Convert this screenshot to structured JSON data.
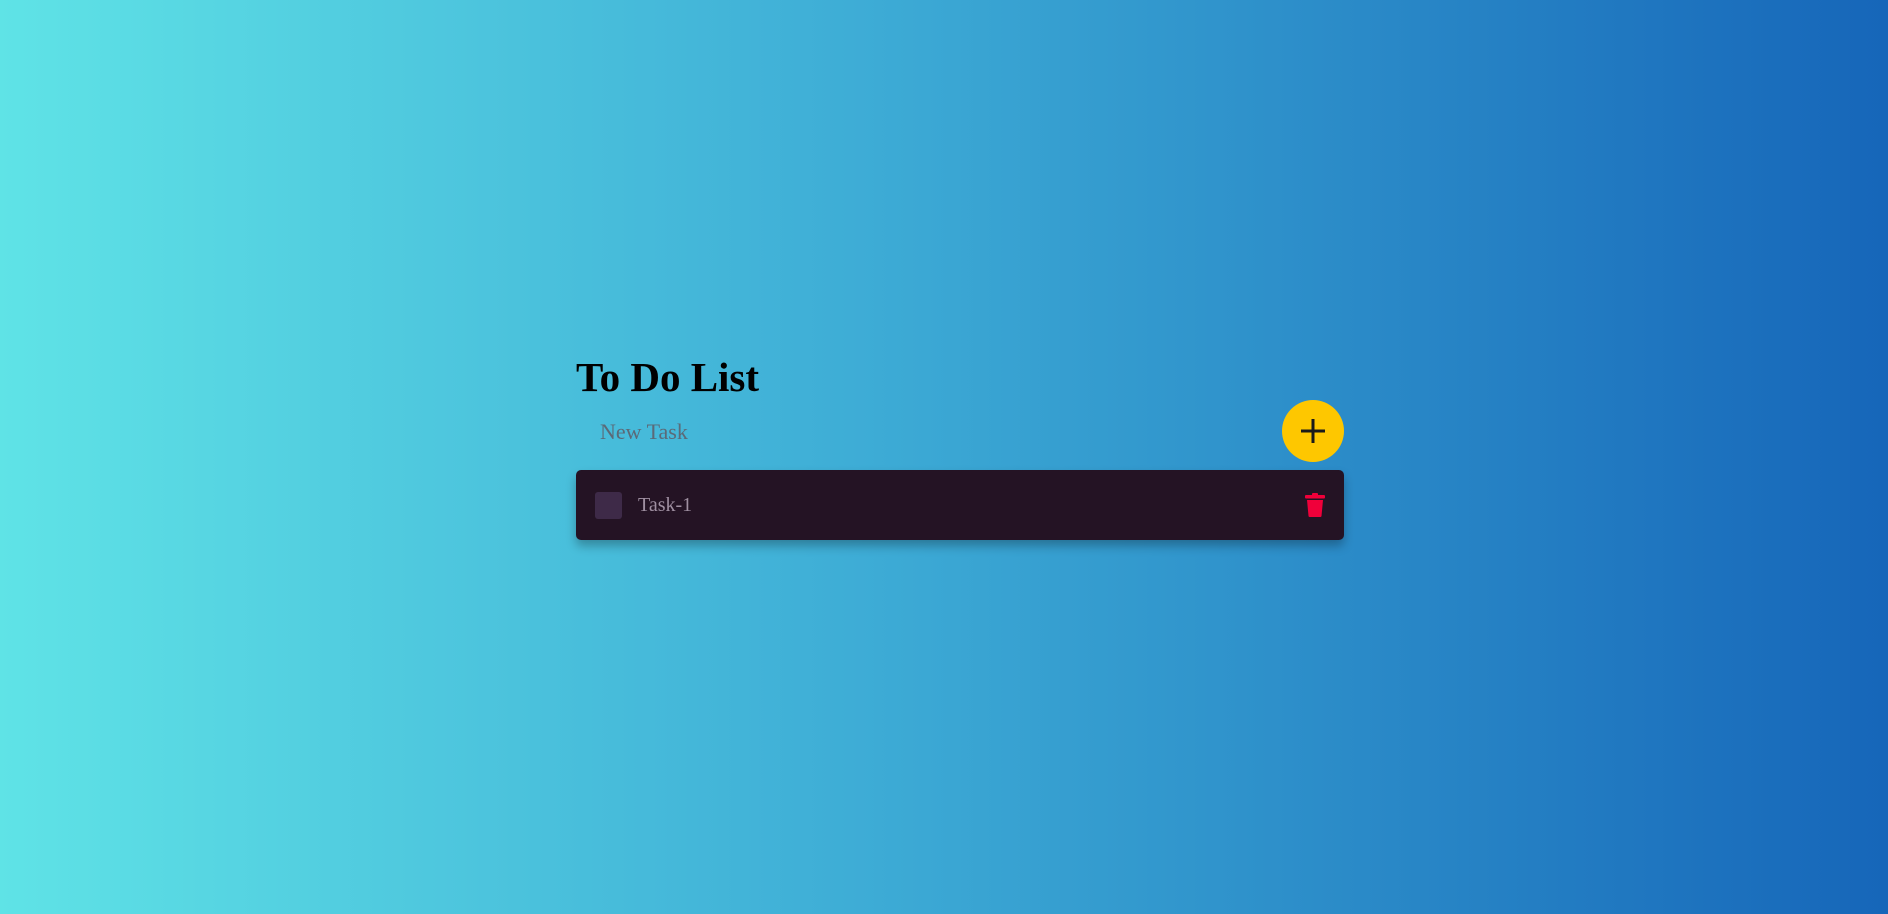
{
  "header": {
    "title": "To Do List"
  },
  "new_task": {
    "placeholder": "New Task",
    "value": "",
    "add_icon": "plus-icon"
  },
  "tasks": [
    {
      "label": "Task-1",
      "completed": false,
      "delete_icon": "trash-icon"
    }
  ],
  "colors": {
    "background_start": "#5fe3e6",
    "background_end": "#1666b9",
    "add_button": "#fec700",
    "task_background": "#241324",
    "checkbox": "#3e2a48",
    "task_text": "#9f8fa1",
    "delete_icon": "#f0003a"
  }
}
